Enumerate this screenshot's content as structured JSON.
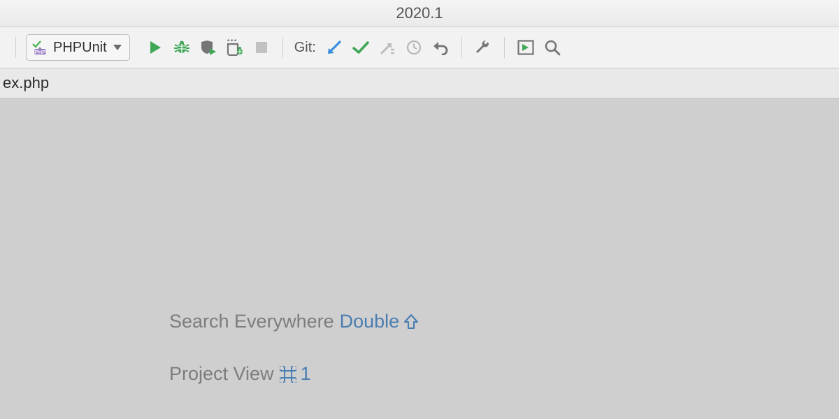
{
  "titlebar": {
    "version": "2020.1"
  },
  "toolbar": {
    "run_config_label": "PHPUnit",
    "git_label": "Git:"
  },
  "tabstrip": {
    "current_file_fragment": "ex.php"
  },
  "hints": {
    "search_label": "Search Everywhere",
    "search_shortcut_prefix": "Double",
    "project_label": "Project View",
    "project_shortcut_key": "1"
  }
}
